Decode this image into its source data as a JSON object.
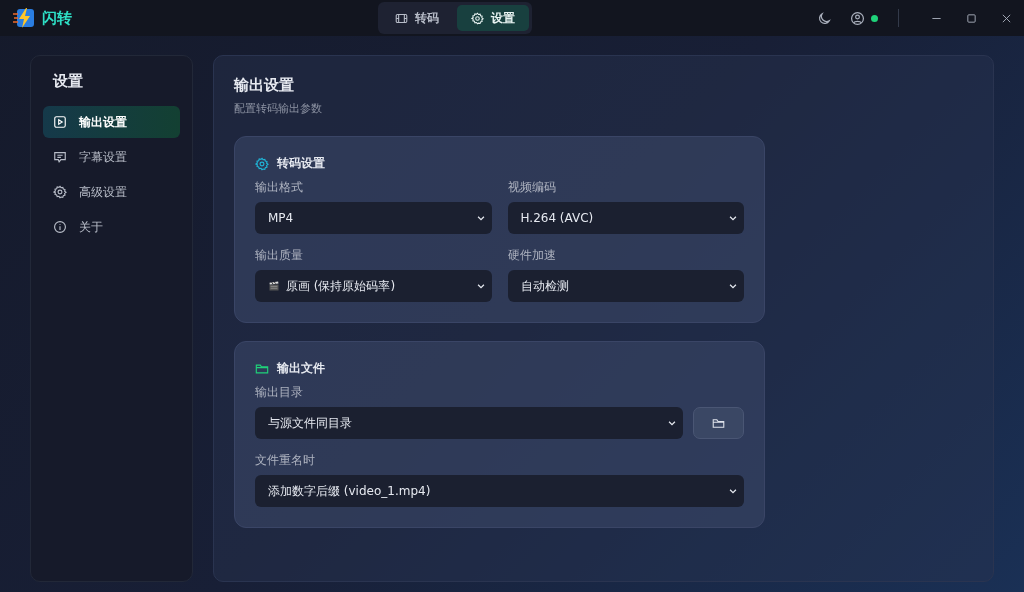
{
  "app": {
    "name": "闪转"
  },
  "nav_tabs": [
    {
      "label": "转码",
      "selected": false
    },
    {
      "label": "设置",
      "selected": true
    }
  ],
  "status": {
    "online": true
  },
  "sidebar": {
    "title": "设置",
    "items": [
      {
        "label": "输出设置",
        "selected": true
      },
      {
        "label": "字幕设置",
        "selected": false
      },
      {
        "label": "高级设置",
        "selected": false
      },
      {
        "label": "关于",
        "selected": false
      }
    ]
  },
  "page": {
    "title": "输出设置",
    "subtitle": "配置转码输出参数"
  },
  "sections": [
    {
      "title": "转码设置",
      "fields": [
        {
          "kind": "select",
          "label": "输出格式",
          "value": "MP4"
        },
        {
          "kind": "select",
          "label": "视频编码",
          "value": "H.264 (AVC)"
        },
        {
          "kind": "icon_select",
          "label": "输出质量",
          "value": "原画 (保持原始码率)"
        },
        {
          "kind": "select",
          "label": "硬件加速",
          "value": "自动检测"
        }
      ]
    },
    {
      "title": "输出文件",
      "fields": [
        {
          "kind": "select_browse",
          "label": "输出目录",
          "value": "与源文件同目录"
        },
        {
          "kind": "select",
          "label": "文件重名时",
          "value": "添加数字后缀 (video_1.mp4)"
        }
      ]
    }
  ]
}
